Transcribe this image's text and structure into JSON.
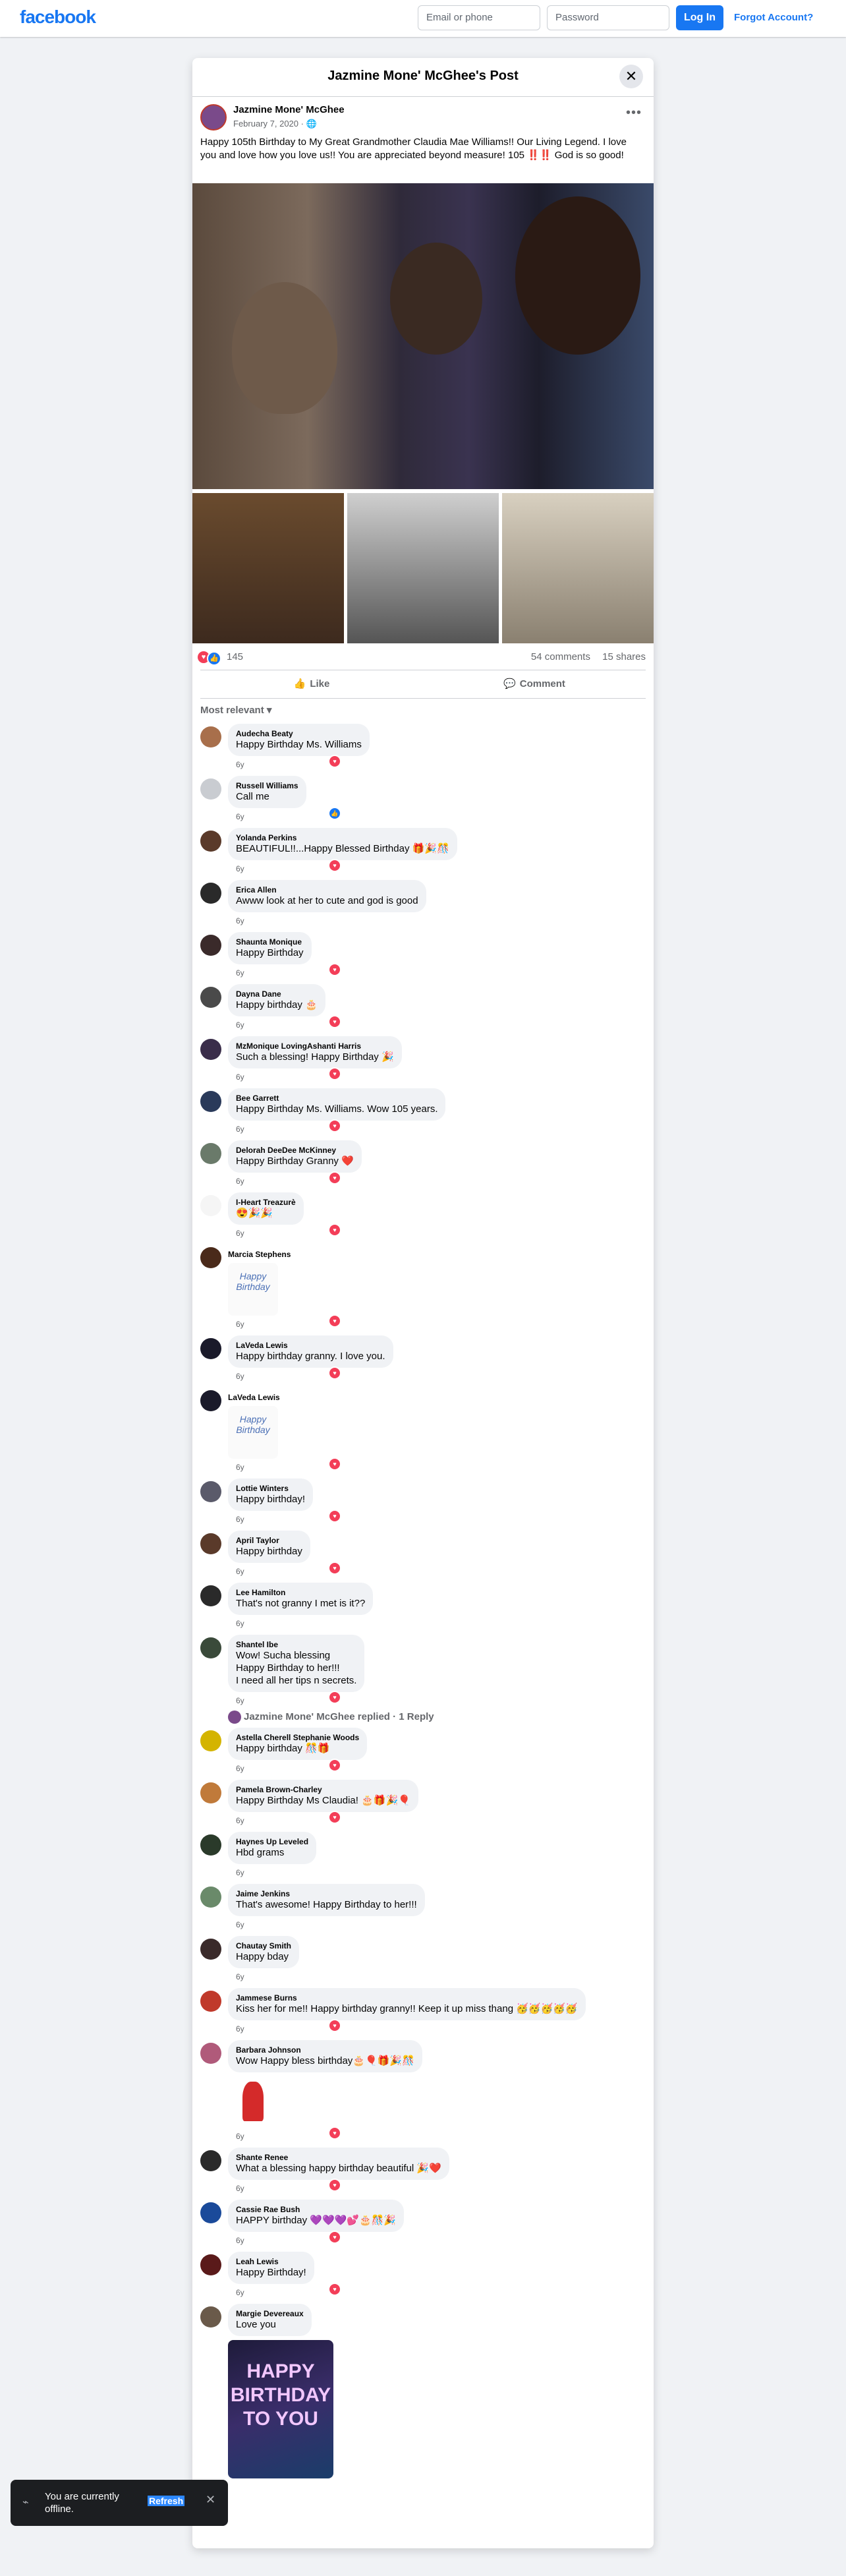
{
  "topbar": {
    "logo": "facebook",
    "email_placeholder": "Email or phone",
    "password_placeholder": "Password",
    "login_label": "Log In",
    "forgot_label": "Forgot Account?"
  },
  "dialog": {
    "title": "Jazmine Mone' McGhee's Post",
    "close_icon": "close-icon"
  },
  "post": {
    "author": "Jazmine Mone' McGhee",
    "date": "February 7, 2020",
    "privacy_icon": "globe-icon",
    "text": "Happy 105th Birthday to My Great Grandmother Claudia Mae Williams!! Our Living Legend. I love you and love how you love us!! You are appreciated beyond measure! 105 ‼️‼️ God is so good!",
    "reaction_count": "145",
    "comments_count": "54 comments",
    "shares_count": "15 shares",
    "like_label": "Like",
    "comment_label": "Comment",
    "sort_label": "Most relevant"
  },
  "comments": [
    {
      "name": "Audecha Beaty",
      "text": "Happy Birthday Ms. Williams",
      "time": "6y",
      "reaction": "love",
      "avatar_color": "#a86f4b"
    },
    {
      "name": "Russell Williams",
      "text": "Call me",
      "time": "6y",
      "reaction": "like",
      "avatar_color": "#c9ccd1"
    },
    {
      "name": "Yolanda Perkins",
      "text": "BEAUTIFUL!!...Happy Blessed Birthday 🎁🎉🎊",
      "time": "6y",
      "reaction": "love",
      "avatar_color": "#5a3a2a"
    },
    {
      "name": "Erica Allen",
      "text": "Awww look at her to cute and god is good",
      "time": "6y",
      "reaction": "",
      "avatar_color": "#2a2a2a"
    },
    {
      "name": "Shaunta Monique",
      "text": "Happy Birthday",
      "time": "6y",
      "reaction": "love",
      "avatar_color": "#3a2a2a"
    },
    {
      "name": "Dayna Dane",
      "text": "Happy birthday 🎂",
      "time": "6y",
      "reaction": "love",
      "avatar_color": "#4a4a4a"
    },
    {
      "name": "MzMonique LovingAshanti Harris",
      "text": "Such a blessing! Happy Birthday 🎉",
      "time": "6y",
      "reaction": "love",
      "avatar_color": "#3a2d4a"
    },
    {
      "name": "Bee Garrett",
      "text": "Happy Birthday Ms. Williams. Wow 105 years.",
      "time": "6y",
      "reaction": "love",
      "avatar_color": "#2a3a5a"
    },
    {
      "name": "Delorah DeeDee McKinney",
      "text": "Happy Birthday Granny ❤️",
      "time": "6y",
      "reaction": "love",
      "avatar_color": "#6a7a6a"
    },
    {
      "name": "I-Heart Treazurè",
      "text": "😍🎉🎉",
      "time": "6y",
      "reaction": "love",
      "avatar_color": "#f5f5f5"
    },
    {
      "name": "Marcia Stephens",
      "text": "",
      "sticker": "Happy Birthday",
      "time": "6y",
      "reaction": "love",
      "avatar_color": "#4a2a1a"
    },
    {
      "name": "LaVeda Lewis",
      "text": "Happy birthday granny. I love you.",
      "time": "6y",
      "reaction": "love",
      "avatar_color": "#1a1a2a"
    },
    {
      "name": "LaVeda Lewis",
      "text": "",
      "sticker": "Happy Birthday",
      "time": "6y",
      "reaction": "love",
      "avatar_color": "#1a1a2a"
    },
    {
      "name": "Lottie Winters",
      "text": "Happy birthday!",
      "time": "6y",
      "reaction": "love",
      "avatar_color": "#5a5a6a"
    },
    {
      "name": "April Taylor",
      "text": "Happy birthday",
      "time": "6y",
      "reaction": "love",
      "avatar_color": "#5a3a2a"
    },
    {
      "name": "Lee Hamilton",
      "text": "That's not granny I met is it??",
      "time": "6y",
      "reaction": "",
      "avatar_color": "#2a2a2a"
    },
    {
      "name": "Shantel Ibe",
      "text": "Wow! Sucha blessing\nHappy Birthday to her!!!\nI need all her tips n secrets.",
      "time": "6y",
      "reaction": "love",
      "avatar_color": "#3a4a3a"
    }
  ],
  "reply_summary": "Jazmine Mone' McGhee replied · 1 Reply",
  "comments2": [
    {
      "name": "Astella Cherell Stephanie Woods",
      "text": "Happy birthday 🎊🎁",
      "time": "6y",
      "reaction": "love",
      "avatar_color": "#d4b400"
    },
    {
      "name": "Pamela Brown-Charley",
      "text": "Happy Birthday Ms Claudia! 🎂🎁🎉🎈",
      "time": "6y",
      "reaction": "love",
      "avatar_color": "#c07a3a"
    },
    {
      "name": "Haynes Up Leveled",
      "text": "Hbd grams",
      "time": "6y",
      "reaction": "",
      "avatar_color": "#2a3a2a"
    },
    {
      "name": "Jaime Jenkins",
      "text": "That's awesome! Happy Birthday to her!!!",
      "time": "6y",
      "reaction": "",
      "avatar_color": "#6a8a6a"
    },
    {
      "name": "Chautay Smith",
      "text": "Happy bday",
      "time": "6y",
      "reaction": "",
      "avatar_color": "#3a2a2a"
    },
    {
      "name": "Jammese Burns",
      "text": "Kiss her for me!! Happy birthday granny!! Keep it up miss thang 🥳🥳🥳🥳🥳",
      "time": "6y",
      "reaction": "love",
      "avatar_color": "#c0392b"
    },
    {
      "name": "Barbara Johnson",
      "text": "Wow Happy bless birthday🎂🎈🎁🎉🎊",
      "sticker2": true,
      "time": "6y",
      "reaction": "love",
      "avatar_color": "#b05a7a"
    },
    {
      "name": "Shante Renee",
      "text": "What a blessing happy birthday beautiful 🎉❤️",
      "time": "6y",
      "reaction": "love",
      "avatar_color": "#2a2a2a"
    },
    {
      "name": "Cassie Rae Bush",
      "text": "HAPPY birthday 💜💜💜💕🎂🎊🎉",
      "time": "6y",
      "reaction": "love",
      "avatar_color": "#1a4a9a"
    },
    {
      "name": "Leah Lewis",
      "text": "Happy Birthday!",
      "time": "6y",
      "reaction": "love",
      "avatar_color": "#5a1a1a"
    },
    {
      "name": "Margie Devereaux",
      "text": "Love you",
      "image_text": "HAPPY BIRTHDAY TO YOU",
      "time": "",
      "reaction": "",
      "avatar_color": "#6a5a4a"
    }
  ],
  "offline_toast": {
    "message": "You are currently offline.",
    "refresh_label": "Refresh"
  }
}
